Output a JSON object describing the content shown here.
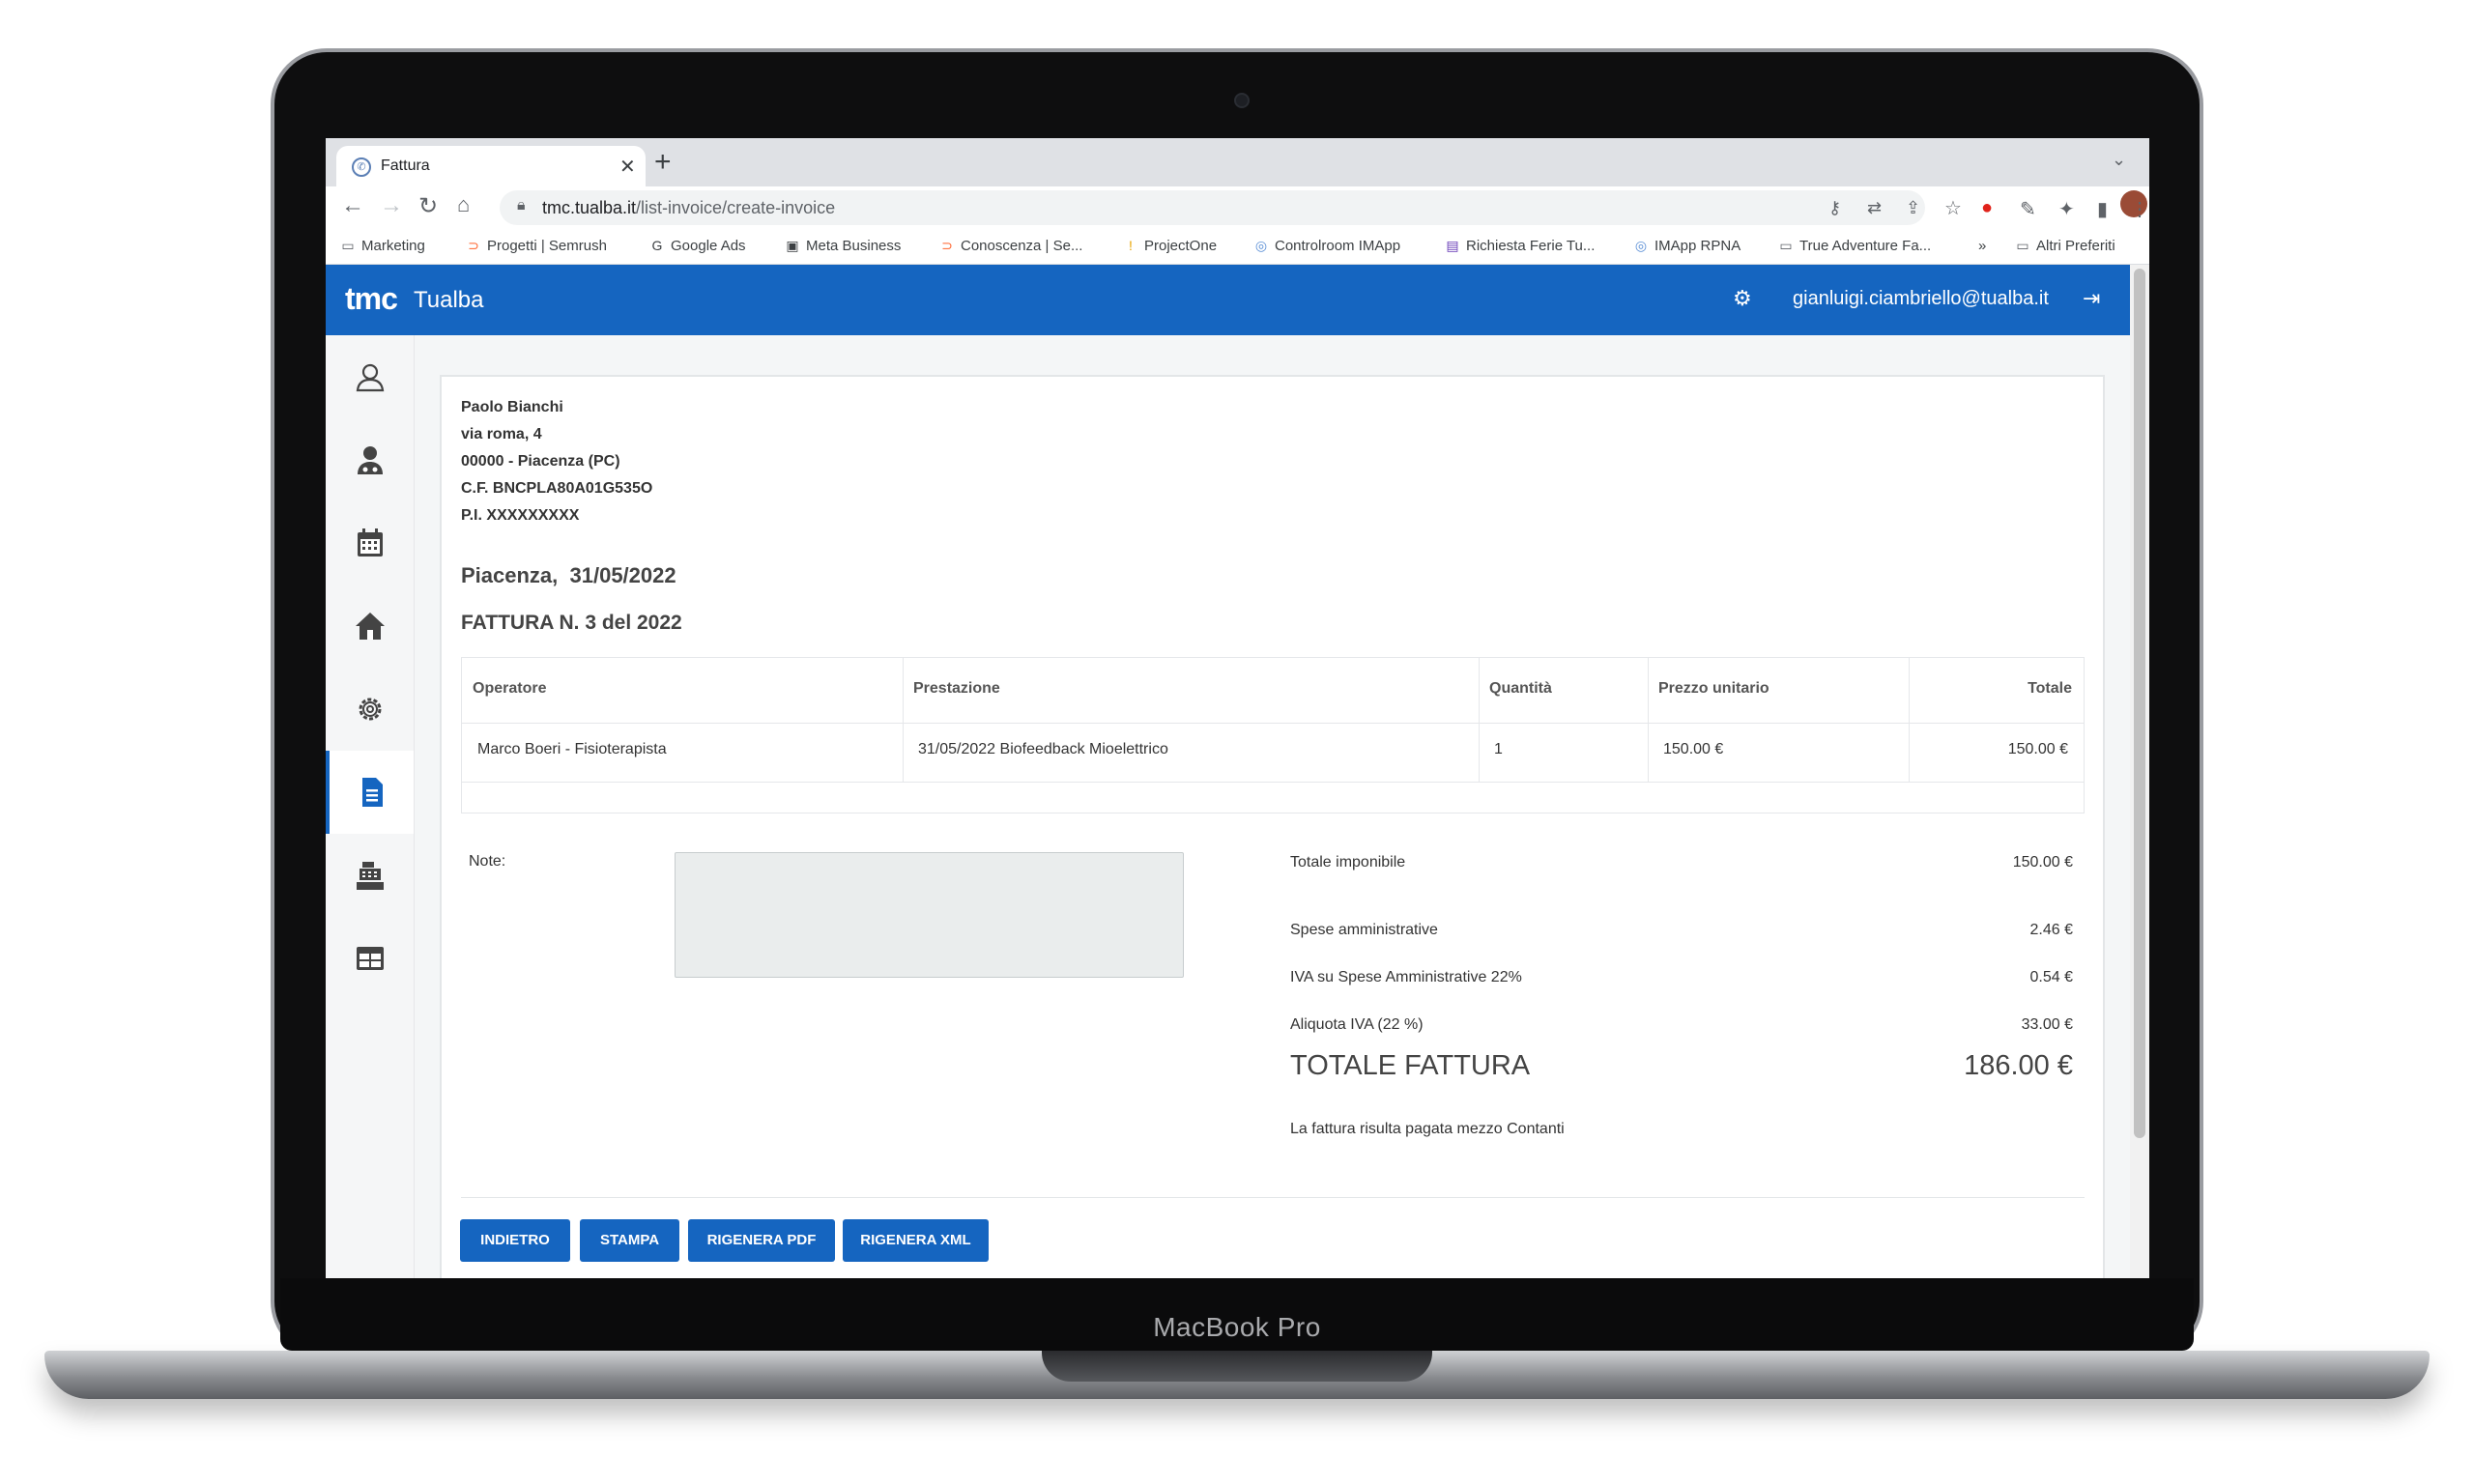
{
  "device": {
    "label": "MacBook Pro"
  },
  "browser": {
    "tab_title": "Fattura",
    "url_host": "tmc.tualba.it",
    "url_path": "/list-invoice/create-invoice",
    "bookmarks": [
      {
        "label": "Marketing",
        "icon": "folder-icon"
      },
      {
        "label": "Progetti | Semrush",
        "icon": "semrush-icon"
      },
      {
        "label": "Google Ads",
        "icon": "google-icon"
      },
      {
        "label": "Meta Business",
        "icon": "meta-icon"
      },
      {
        "label": "Conoscenza | Se...",
        "icon": "semrush-icon"
      },
      {
        "label": "ProjectOne",
        "icon": "projectone-icon"
      },
      {
        "label": "Controlroom IMApp",
        "icon": "globe-icon"
      },
      {
        "label": "Richiesta Ferie Tu...",
        "icon": "form-icon"
      },
      {
        "label": "IMApp RPNA",
        "icon": "globe-icon"
      },
      {
        "label": "True Adventure Fa...",
        "icon": "folder-icon"
      }
    ],
    "bookmarks_more": "»",
    "other_bookmarks": "Altri Preferiti"
  },
  "header": {
    "logo": "tmc",
    "brand": "Tualba",
    "user_email": "gianluigi.ciambriello@tualba.it",
    "accent_color": "#1565c0"
  },
  "sidebar": {
    "items": [
      {
        "name": "patients",
        "icon": "user-icon",
        "active": false
      },
      {
        "name": "operators",
        "icon": "doctor-icon",
        "active": false
      },
      {
        "name": "calendar",
        "icon": "calendar-icon",
        "active": false
      },
      {
        "name": "home",
        "icon": "home-icon",
        "active": false
      },
      {
        "name": "settings",
        "icon": "gear-icon",
        "active": false
      },
      {
        "name": "invoices",
        "icon": "document-icon",
        "active": true
      },
      {
        "name": "cash-register",
        "icon": "cash-register-icon",
        "active": false
      },
      {
        "name": "tables",
        "icon": "table-icon",
        "active": false
      }
    ]
  },
  "customer": {
    "name": "Paolo Bianchi",
    "street": "via roma, 4",
    "city": "00000 - Piacenza (PC)",
    "tax_code": "C.F. BNCPLA80A01G535O",
    "vat": "P.I. XXXXXXXXX"
  },
  "invoice": {
    "city_date": "Piacenza,  31/05/2022",
    "title": "FATTURA N. 3 del 2022"
  },
  "table": {
    "headers": [
      "Operatore",
      "Prestazione",
      "Quantità",
      "Prezzo unitario",
      "Totale"
    ],
    "rows": [
      [
        "Marco Boeri - Fisioterapista",
        "31/05/2022 Biofeedback Mioelettrico",
        "1",
        "150.00 €",
        "150.00 €"
      ]
    ]
  },
  "notes": {
    "label": "Note:",
    "value": ""
  },
  "summary": {
    "taxable_label": "Totale imponibile",
    "taxable_value": "150.00 €",
    "admin_label": "Spese amministrative",
    "admin_value": "2.46 €",
    "admin_vat_label": "IVA su Spese Amministrative 22%",
    "admin_vat_value": "0.54 €",
    "vat_label": "Aliquota IVA (22 %)",
    "vat_value": "33.00 €",
    "total_label": "TOTALE FATTURA",
    "total_value": "186.00 €",
    "paid_note": "La fattura risulta pagata mezzo Contanti"
  },
  "actions": {
    "back": "INDIETRO",
    "print": "STAMPA",
    "regen_pdf": "RIGENERA PDF",
    "regen_xml": "RIGENERA XML"
  }
}
